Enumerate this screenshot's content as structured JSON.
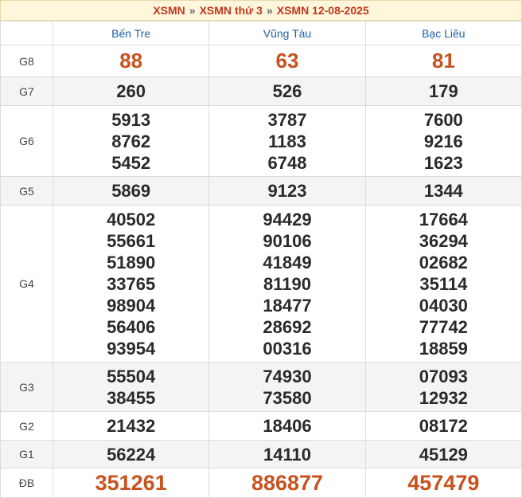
{
  "breadcrumb": {
    "items": [
      "XSMN",
      "XSMN thứ 3",
      "XSMN 12-08-2025"
    ],
    "separator": "»"
  },
  "provinces": [
    "Bến Tre",
    "Vũng Tàu",
    "Bạc Liêu"
  ],
  "prizes": [
    {
      "label": "G8",
      "values": [
        [
          "88"
        ],
        [
          "63"
        ],
        [
          "81"
        ]
      ]
    },
    {
      "label": "G7",
      "values": [
        [
          "260"
        ],
        [
          "526"
        ],
        [
          "179"
        ]
      ]
    },
    {
      "label": "G6",
      "values": [
        [
          "5913",
          "8762",
          "5452"
        ],
        [
          "3787",
          "1183",
          "6748"
        ],
        [
          "7600",
          "9216",
          "1623"
        ]
      ]
    },
    {
      "label": "G5",
      "values": [
        [
          "5869"
        ],
        [
          "9123"
        ],
        [
          "1344"
        ]
      ]
    },
    {
      "label": "G4",
      "values": [
        [
          "40502",
          "55661",
          "51890",
          "33765",
          "98904",
          "56406",
          "93954"
        ],
        [
          "94429",
          "90106",
          "41849",
          "81190",
          "18477",
          "28692",
          "00316"
        ],
        [
          "17664",
          "36294",
          "02682",
          "35114",
          "04030",
          "77742",
          "18859"
        ]
      ]
    },
    {
      "label": "G3",
      "values": [
        [
          "55504",
          "38455"
        ],
        [
          "74930",
          "73580"
        ],
        [
          "07093",
          "12932"
        ]
      ]
    },
    {
      "label": "G2",
      "values": [
        [
          "21432"
        ],
        [
          "18406"
        ],
        [
          "08172"
        ]
      ]
    },
    {
      "label": "G1",
      "values": [
        [
          "56224"
        ],
        [
          "14110"
        ],
        [
          "45129"
        ]
      ]
    },
    {
      "label": "ĐB",
      "values": [
        [
          "351261"
        ],
        [
          "886877"
        ],
        [
          "457479"
        ]
      ]
    }
  ],
  "colors": {
    "accent": "#c7521e",
    "header_bg": "#fff6dc",
    "province": "#1f5fa5"
  }
}
